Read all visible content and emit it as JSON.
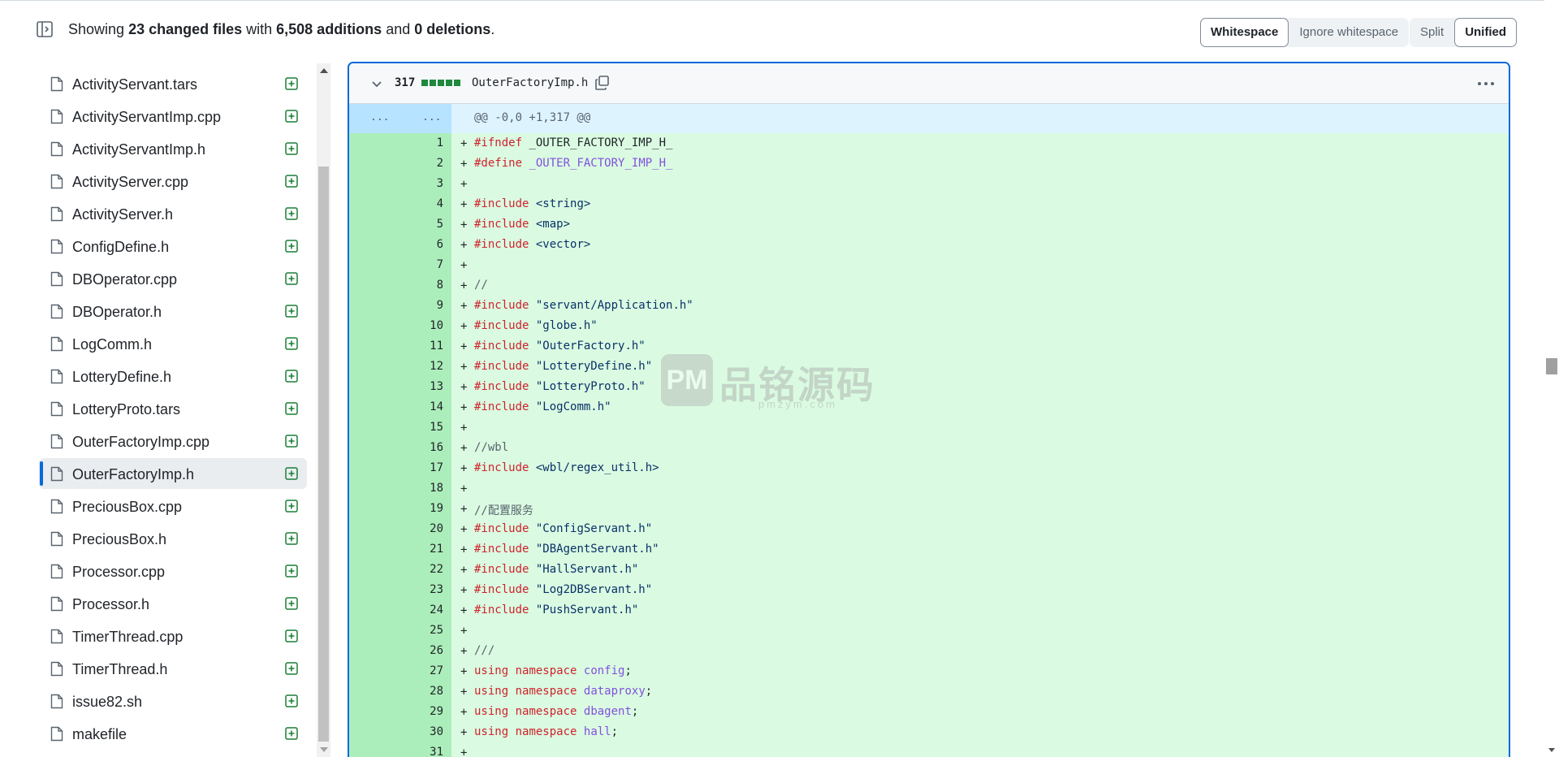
{
  "summary": {
    "prefix": "Showing ",
    "changed": "23 changed files",
    "with": " with ",
    "additions": "6,508 additions",
    "and": " and ",
    "deletions": "0 deletions",
    "suffix": "."
  },
  "whitespace_toggle": {
    "whitespace": "Whitespace",
    "ignore": "Ignore whitespace",
    "active": "Whitespace"
  },
  "view_toggle": {
    "split": "Split",
    "unified": "Unified",
    "active": "Unified"
  },
  "file_tree": {
    "selected": "OuterFactoryImp.h",
    "items": [
      "ActivityServant.tars",
      "ActivityServantImp.cpp",
      "ActivityServantImp.h",
      "ActivityServer.cpp",
      "ActivityServer.h",
      "ConfigDefine.h",
      "DBOperator.cpp",
      "DBOperator.h",
      "LogComm.h",
      "LotteryDefine.h",
      "LotteryProto.tars",
      "OuterFactoryImp.cpp",
      "OuterFactoryImp.h",
      "PreciousBox.cpp",
      "PreciousBox.h",
      "Processor.cpp",
      "Processor.h",
      "TimerThread.cpp",
      "TimerThread.h",
      "issue82.sh",
      "makefile"
    ]
  },
  "diff": {
    "line_count": "317",
    "file_path": "OuterFactoryImp.h",
    "hunk_gutter_left": "...",
    "hunk_gutter_right": "...",
    "hunk_header": "@@ -0,0 +1,317 @@",
    "lines": [
      {
        "n": "1",
        "t": [
          [
            "k",
            "#ifndef"
          ],
          [
            "",
            " _OUTER_FACTORY_IMP_H_"
          ]
        ]
      },
      {
        "n": "2",
        "t": [
          [
            "k",
            "#define"
          ],
          [
            "",
            " "
          ],
          [
            "n",
            "_OUTER_FACTORY_IMP_H_"
          ]
        ]
      },
      {
        "n": "3",
        "t": []
      },
      {
        "n": "4",
        "t": [
          [
            "k",
            "#include"
          ],
          [
            "",
            " "
          ],
          [
            "s",
            "<string>"
          ]
        ]
      },
      {
        "n": "5",
        "t": [
          [
            "k",
            "#include"
          ],
          [
            "",
            " "
          ],
          [
            "s",
            "<map>"
          ]
        ]
      },
      {
        "n": "6",
        "t": [
          [
            "k",
            "#include"
          ],
          [
            "",
            " "
          ],
          [
            "s",
            "<vector>"
          ]
        ]
      },
      {
        "n": "7",
        "t": []
      },
      {
        "n": "8",
        "t": [
          [
            "c",
            "//"
          ]
        ]
      },
      {
        "n": "9",
        "t": [
          [
            "k",
            "#include"
          ],
          [
            "",
            " "
          ],
          [
            "s",
            "\"servant/Application.h\""
          ]
        ]
      },
      {
        "n": "10",
        "t": [
          [
            "k",
            "#include"
          ],
          [
            "",
            " "
          ],
          [
            "s",
            "\"globe.h\""
          ]
        ]
      },
      {
        "n": "11",
        "t": [
          [
            "k",
            "#include"
          ],
          [
            "",
            " "
          ],
          [
            "s",
            "\"OuterFactory.h\""
          ]
        ]
      },
      {
        "n": "12",
        "t": [
          [
            "k",
            "#include"
          ],
          [
            "",
            " "
          ],
          [
            "s",
            "\"LotteryDefine.h\""
          ]
        ]
      },
      {
        "n": "13",
        "t": [
          [
            "k",
            "#include"
          ],
          [
            "",
            " "
          ],
          [
            "s",
            "\"LotteryProto.h\""
          ]
        ]
      },
      {
        "n": "14",
        "t": [
          [
            "k",
            "#include"
          ],
          [
            "",
            " "
          ],
          [
            "s",
            "\"LogComm.h\""
          ]
        ]
      },
      {
        "n": "15",
        "t": []
      },
      {
        "n": "16",
        "t": [
          [
            "c",
            "//wbl"
          ]
        ]
      },
      {
        "n": "17",
        "t": [
          [
            "k",
            "#include"
          ],
          [
            "",
            " "
          ],
          [
            "s",
            "<wbl/regex_util.h>"
          ]
        ]
      },
      {
        "n": "18",
        "t": []
      },
      {
        "n": "19",
        "t": [
          [
            "c",
            "//配置服务"
          ]
        ]
      },
      {
        "n": "20",
        "t": [
          [
            "k",
            "#include"
          ],
          [
            "",
            " "
          ],
          [
            "s",
            "\"ConfigServant.h\""
          ]
        ]
      },
      {
        "n": "21",
        "t": [
          [
            "k",
            "#include"
          ],
          [
            "",
            " "
          ],
          [
            "s",
            "\"DBAgentServant.h\""
          ]
        ]
      },
      {
        "n": "22",
        "t": [
          [
            "k",
            "#include"
          ],
          [
            "",
            " "
          ],
          [
            "s",
            "\"HallServant.h\""
          ]
        ]
      },
      {
        "n": "23",
        "t": [
          [
            "k",
            "#include"
          ],
          [
            "",
            " "
          ],
          [
            "s",
            "\"Log2DBServant.h\""
          ]
        ]
      },
      {
        "n": "24",
        "t": [
          [
            "k",
            "#include"
          ],
          [
            "",
            " "
          ],
          [
            "s",
            "\"PushServant.h\""
          ]
        ]
      },
      {
        "n": "25",
        "t": []
      },
      {
        "n": "26",
        "t": [
          [
            "c",
            "///"
          ]
        ]
      },
      {
        "n": "27",
        "t": [
          [
            "k",
            "using"
          ],
          [
            "",
            " "
          ],
          [
            "k",
            "namespace"
          ],
          [
            "",
            " "
          ],
          [
            "n",
            "config"
          ],
          [
            "",
            ";"
          ]
        ]
      },
      {
        "n": "28",
        "t": [
          [
            "k",
            "using"
          ],
          [
            "",
            " "
          ],
          [
            "k",
            "namespace"
          ],
          [
            "",
            " "
          ],
          [
            "n",
            "dataproxy"
          ],
          [
            "",
            ";"
          ]
        ]
      },
      {
        "n": "29",
        "t": [
          [
            "k",
            "using"
          ],
          [
            "",
            " "
          ],
          [
            "k",
            "namespace"
          ],
          [
            "",
            " "
          ],
          [
            "n",
            "dbagent"
          ],
          [
            "",
            ";"
          ]
        ]
      },
      {
        "n": "30",
        "t": [
          [
            "k",
            "using"
          ],
          [
            "",
            " "
          ],
          [
            "k",
            "namespace"
          ],
          [
            "",
            " "
          ],
          [
            "n",
            "hall"
          ],
          [
            "",
            ";"
          ]
        ]
      },
      {
        "n": "31",
        "t": []
      }
    ]
  },
  "watermark": {
    "logo": "PM",
    "name": "品铭源码",
    "url": "pmzym.com"
  },
  "colors": {
    "accent": "#0969da",
    "addition_gutter": "#aceebb",
    "addition_line": "#dafbe1",
    "hunk": "#ddf4ff",
    "diffstat": "#1f883d"
  },
  "icons": {
    "tree_toggle": "sidebar-expand-icon",
    "file": "file-icon",
    "added": "diff-added-icon",
    "collapse": "chevron-down-icon",
    "copy": "copy-icon",
    "menu": "kebab-horizontal-icon"
  }
}
